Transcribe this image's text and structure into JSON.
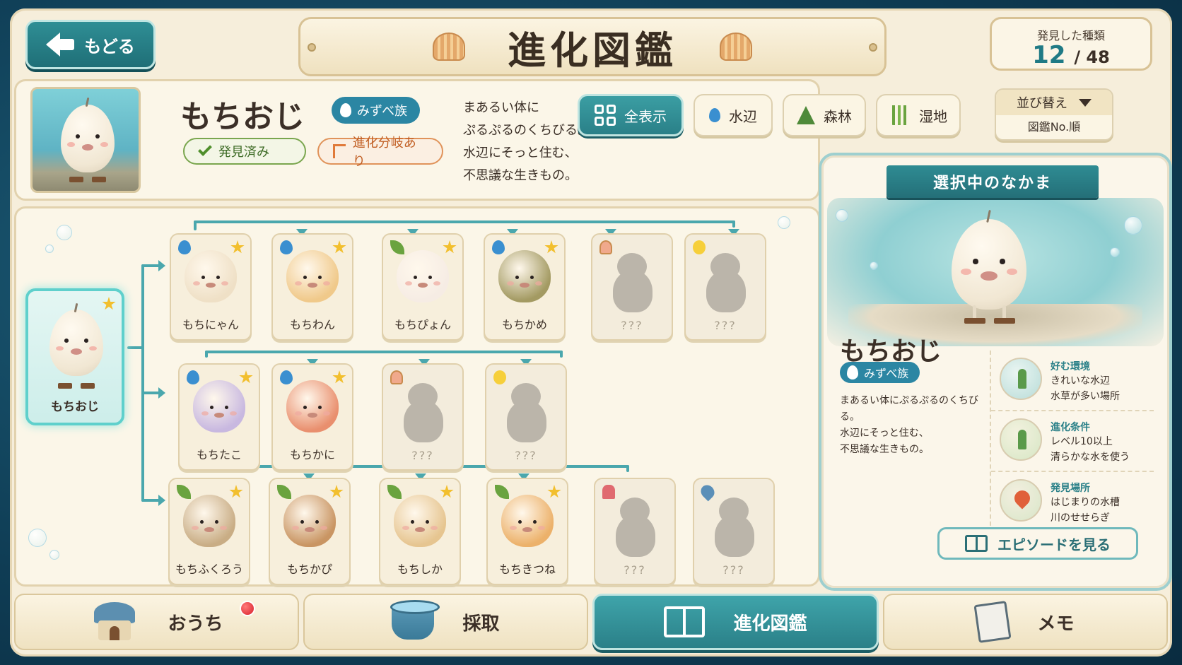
{
  "header": {
    "back_label": "もどる",
    "title": "進化図鑑",
    "count_label": "発見した種類",
    "count_found": "12",
    "count_total": "/ 48"
  },
  "selected": {
    "name": "もちおじ",
    "tribe": "みずべ族",
    "found_label": "発見済み",
    "branch_label": "進化分岐あり",
    "desc_lines": [
      "まあるい体に",
      "ぷるぷるのくちびる。",
      "水辺にそっと住む、",
      "不思議な生きもの。"
    ]
  },
  "filters": {
    "all": "全表示",
    "water": "水辺",
    "forest": "森林",
    "wetland": "湿地",
    "sort_label": "並び替え",
    "sort_value": "図鑑No.順"
  },
  "tree": {
    "root": {
      "name": "もちおじ"
    },
    "rows": [
      [
        {
          "name": "もちにゃん",
          "attr": "water",
          "star": true,
          "color": "#efe0c6"
        },
        {
          "name": "もちわん",
          "attr": "water",
          "star": true,
          "color": "#f0c98a"
        },
        {
          "name": "もちぴょん",
          "attr": "leaf",
          "star": true,
          "color": "#f6ece4"
        },
        {
          "name": "もちかめ",
          "attr": "water",
          "star": true,
          "color": "#a39a62"
        },
        {
          "name": "???",
          "attr": "shell",
          "star": false,
          "locked": true
        },
        {
          "name": "???",
          "attr": "duck",
          "star": false,
          "locked": true
        }
      ],
      [
        {
          "name": "もちたこ",
          "attr": "water",
          "star": true,
          "color": "#c8b8e0"
        },
        {
          "name": "もちかに",
          "attr": "water",
          "star": true,
          "color": "#e98f6e"
        },
        {
          "name": "???",
          "attr": "shell",
          "star": false,
          "locked": true
        },
        {
          "name": "???",
          "attr": "duck",
          "star": false,
          "locked": true
        }
      ],
      [
        {
          "name": "もちふくろう",
          "attr": "leaf",
          "star": true,
          "color": "#c9ad85"
        },
        {
          "name": "もちかぴ",
          "attr": "leaf",
          "star": true,
          "color": "#c99563"
        },
        {
          "name": "もちしか",
          "attr": "leaf",
          "star": true,
          "color": "#e6c590"
        },
        {
          "name": "もちきつね",
          "attr": "leaf",
          "star": true,
          "color": "#ecb16a"
        },
        {
          "name": "???",
          "attr": "coral",
          "star": false,
          "locked": true
        },
        {
          "name": "???",
          "attr": "pin",
          "star": false,
          "locked": true
        }
      ]
    ]
  },
  "side": {
    "ribbon": "選択中のなかま",
    "name": "もちおじ",
    "tribe": "みずべ族",
    "desc_lines": [
      "まあるい体にぷるぷるのくちびる。",
      "水辺にそっと住む、",
      "不思議な生きもの。"
    ],
    "rows": [
      {
        "title": "好む環境",
        "lines": [
          "きれいな水辺",
          "水草が多い場所"
        ],
        "icon": "plant-icon"
      },
      {
        "title": "進化条件",
        "lines": [
          "レベル10以上",
          "清らかな水を使う"
        ],
        "icon": "sprout-icon"
      },
      {
        "title": "発見場所",
        "lines": [
          "はじまりの水槽",
          "川のせせらぎ"
        ],
        "icon": "map-pin-icon"
      }
    ],
    "episode_label": "エピソードを見る"
  },
  "nav": {
    "home": "おうち",
    "gather": "採取",
    "dex": "進化図鑑",
    "memo": "メモ"
  },
  "colors": {
    "accent": "#2a8088",
    "tribe_badge": "#2b86a3",
    "star": "#f2bf2e",
    "connector": "#4aa7ad"
  }
}
